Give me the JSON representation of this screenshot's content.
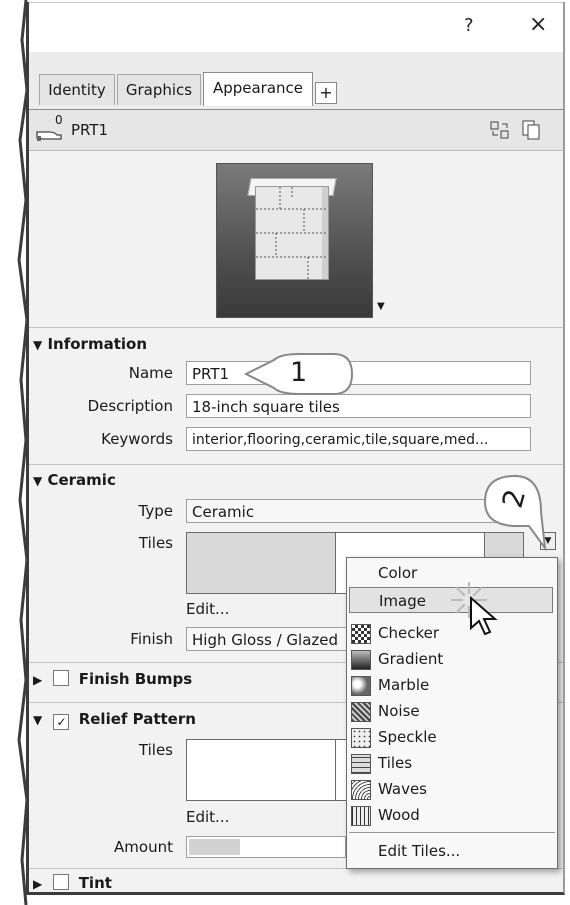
{
  "window": {
    "help_label": "?",
    "close_label": "×"
  },
  "tabs": [
    {
      "label": "Identity"
    },
    {
      "label": "Graphics"
    },
    {
      "label": "Appearance"
    }
  ],
  "tab_add_label": "+",
  "header": {
    "count": "0",
    "name": "PRT1"
  },
  "information": {
    "title": "Information",
    "name_label": "Name",
    "name_value": "PRT1",
    "description_label": "Description",
    "description_value": "18-inch square tiles",
    "keywords_label": "Keywords",
    "keywords_value": "interior,flooring,ceramic,tile,square,med..."
  },
  "ceramic": {
    "title": "Ceramic",
    "type_label": "Type",
    "type_value": "Ceramic",
    "tiles_label": "Tiles",
    "edit_label": "Edit...",
    "finish_label": "Finish",
    "finish_value": "High Gloss / Glazed"
  },
  "finish_bumps": {
    "title": "Finish Bumps"
  },
  "relief_pattern": {
    "title": "Relief Pattern",
    "tiles_label": "Tiles",
    "edit_label": "Edit...",
    "amount_label": "Amount",
    "amount_fraction": 0.33
  },
  "tint": {
    "title": "Tint"
  },
  "dropdown_menu": {
    "items": [
      {
        "label": "Color",
        "icon": "none"
      },
      {
        "label": "Image",
        "icon": "none"
      },
      {
        "label": "Checker",
        "icon": "checker-icon"
      },
      {
        "label": "Gradient",
        "icon": "gradient-icon"
      },
      {
        "label": "Marble",
        "icon": "marble-icon"
      },
      {
        "label": "Noise",
        "icon": "noise-icon"
      },
      {
        "label": "Speckle",
        "icon": "speckle-icon"
      },
      {
        "label": "Tiles",
        "icon": "tiles-icon"
      },
      {
        "label": "Waves",
        "icon": "waves-icon"
      },
      {
        "label": "Wood",
        "icon": "wood-icon"
      }
    ],
    "edit_tiles_label": "Edit Tiles..."
  },
  "callouts": {
    "one": "1",
    "two": "2"
  }
}
